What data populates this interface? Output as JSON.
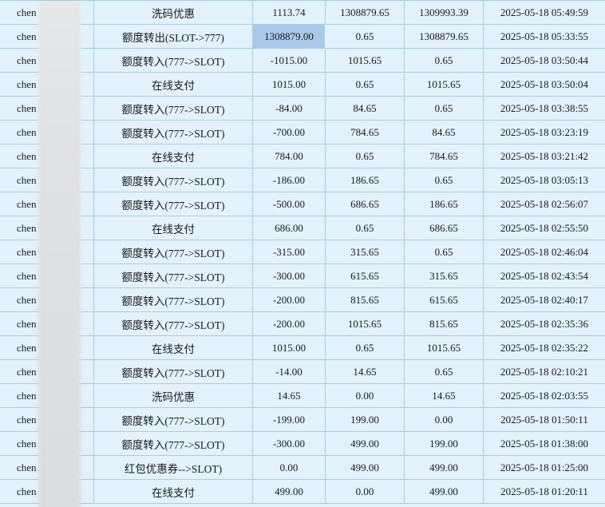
{
  "table": {
    "username_prefix": "chen",
    "username_redacted": true,
    "selected_cell": {
      "row_index": 1,
      "field": "amount"
    },
    "rows": [
      {
        "type": "洗码优惠",
        "amount": "1113.74",
        "before": "1308879.65",
        "after": "1309993.39",
        "time": "2025-05-18 05:49:59"
      },
      {
        "type": "额度转出(SLOT->777)",
        "amount": "1308879.00",
        "before": "0.65",
        "after": "1308879.65",
        "time": "2025-05-18 05:33:55"
      },
      {
        "type": "额度转入(777->SLOT)",
        "amount": "-1015.00",
        "before": "1015.65",
        "after": "0.65",
        "time": "2025-05-18 03:50:44"
      },
      {
        "type": "在线支付",
        "amount": "1015.00",
        "before": "0.65",
        "after": "1015.65",
        "time": "2025-05-18 03:50:04"
      },
      {
        "type": "额度转入(777->SLOT)",
        "amount": "-84.00",
        "before": "84.65",
        "after": "0.65",
        "time": "2025-05-18 03:38:55"
      },
      {
        "type": "额度转入(777->SLOT)",
        "amount": "-700.00",
        "before": "784.65",
        "after": "84.65",
        "time": "2025-05-18 03:23:19"
      },
      {
        "type": "在线支付",
        "amount": "784.00",
        "before": "0.65",
        "after": "784.65",
        "time": "2025-05-18 03:21:42"
      },
      {
        "type": "额度转入(777->SLOT)",
        "amount": "-186.00",
        "before": "186.65",
        "after": "0.65",
        "time": "2025-05-18 03:05:13"
      },
      {
        "type": "额度转入(777->SLOT)",
        "amount": "-500.00",
        "before": "686.65",
        "after": "186.65",
        "time": "2025-05-18 02:56:07"
      },
      {
        "type": "在线支付",
        "amount": "686.00",
        "before": "0.65",
        "after": "686.65",
        "time": "2025-05-18 02:55:50"
      },
      {
        "type": "额度转入(777->SLOT)",
        "amount": "-315.00",
        "before": "315.65",
        "after": "0.65",
        "time": "2025-05-18 02:46:04"
      },
      {
        "type": "额度转入(777->SLOT)",
        "amount": "-300.00",
        "before": "615.65",
        "after": "315.65",
        "time": "2025-05-18 02:43:54"
      },
      {
        "type": "额度转入(777->SLOT)",
        "amount": "-200.00",
        "before": "815.65",
        "after": "615.65",
        "time": "2025-05-18 02:40:17"
      },
      {
        "type": "额度转入(777->SLOT)",
        "amount": "-200.00",
        "before": "1015.65",
        "after": "815.65",
        "time": "2025-05-18 02:35:36"
      },
      {
        "type": "在线支付",
        "amount": "1015.00",
        "before": "0.65",
        "after": "1015.65",
        "time": "2025-05-18 02:35:22"
      },
      {
        "type": "额度转入(777->SLOT)",
        "amount": "-14.00",
        "before": "14.65",
        "after": "0.65",
        "time": "2025-05-18 02:10:21"
      },
      {
        "type": "洗码优惠",
        "amount": "14.65",
        "before": "0.00",
        "after": "14.65",
        "time": "2025-05-18 02:03:55"
      },
      {
        "type": "额度转入(777->SLOT)",
        "amount": "-199.00",
        "before": "199.00",
        "after": "0.00",
        "time": "2025-05-18 01:50:11"
      },
      {
        "type": "额度转入(777->SLOT)",
        "amount": "-300.00",
        "before": "499.00",
        "after": "199.00",
        "time": "2025-05-18 01:38:00"
      },
      {
        "type": "红包优惠券-->SLOT)",
        "amount": "0.00",
        "before": "499.00",
        "after": "499.00",
        "time": "2025-05-18 01:25:00"
      },
      {
        "type": "在线支付",
        "amount": "499.00",
        "before": "0.00",
        "after": "499.00",
        "time": "2025-05-18 01:20:11"
      }
    ]
  },
  "colors": {
    "row_background": "#e3f1fc",
    "grid_border": "#a6d0e0",
    "selected_cell_background": "#aac9ea",
    "text": "#161a20",
    "redaction_gray": "#dfe1e4"
  }
}
